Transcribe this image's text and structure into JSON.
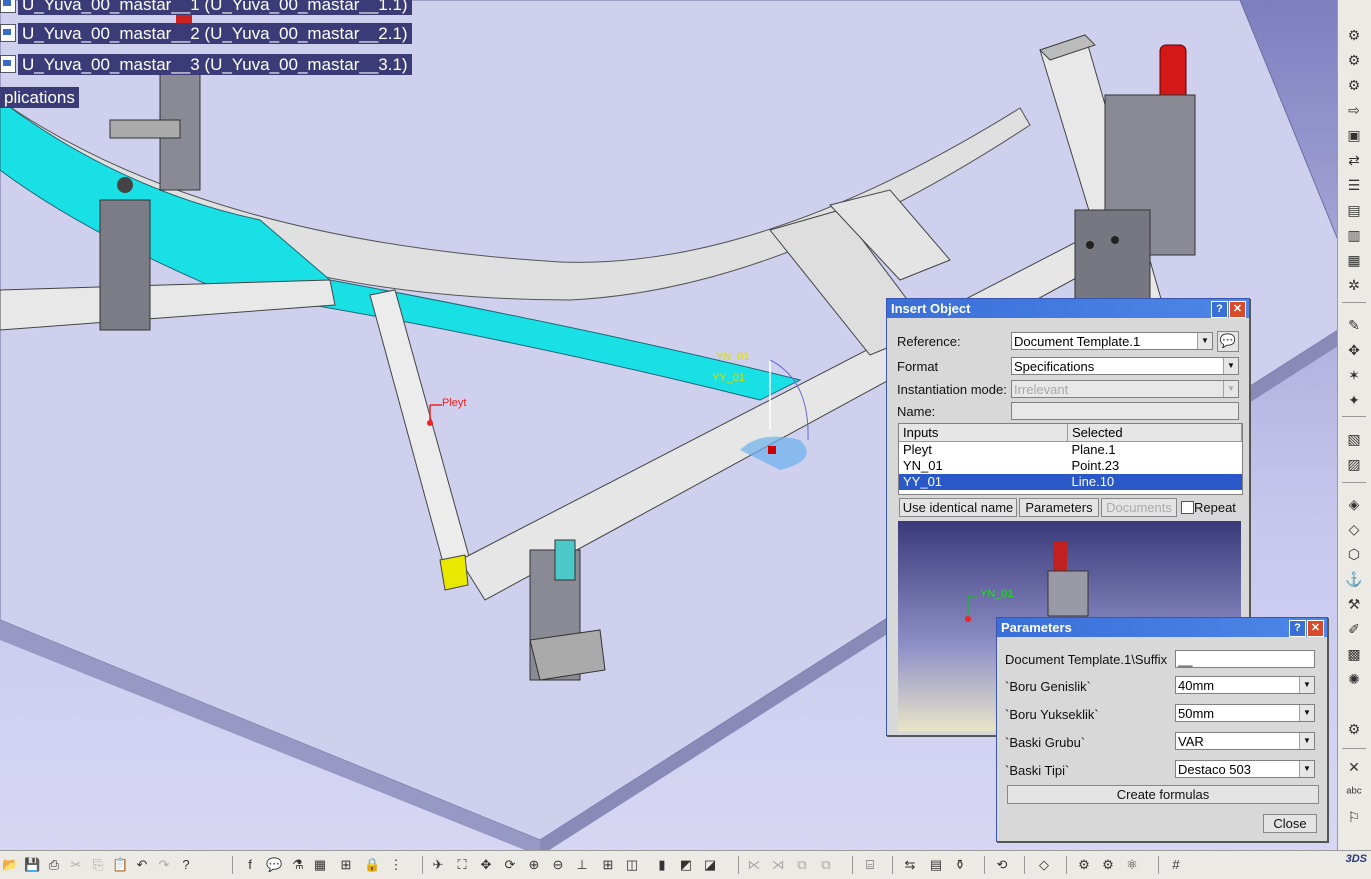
{
  "tree": {
    "nodes": [
      "U_Yuva_00_mastar__1 (U_Yuva_00_mastar__1.1)",
      "U_Yuva_00_mastar__2 (U_Yuva_00_mastar__2.1)",
      "U_Yuva_00_mastar__3 (U_Yuva_00_mastar__3.1)"
    ],
    "applications": "plications"
  },
  "viewport_labels": {
    "pleyt": "Pleyt",
    "yn01": "YN_01",
    "yy01": "YY_01"
  },
  "insert_object": {
    "title": "Insert Object",
    "reference_label": "Reference:",
    "reference_value": "Document Template.1",
    "format_label": "Format",
    "format_value": "Specifications",
    "instantiation_label": "Instantiation mode:",
    "instantiation_value": "Irrelevant",
    "name_label": "Name:",
    "name_value": "",
    "table_headers": [
      "Inputs",
      "Selected"
    ],
    "rows": [
      {
        "input": "Pleyt",
        "selected": "Plane.1"
      },
      {
        "input": "YN_01",
        "selected": "Point.23"
      },
      {
        "input": "YY_01",
        "selected": "Line.10"
      }
    ],
    "use_identical_name": "Use identical name",
    "parameters_button": "Parameters",
    "documents_button": "Documents",
    "repeat_label": "Repeat",
    "preview_label": "YN_01"
  },
  "parameters": {
    "title": "Parameters",
    "rows": [
      {
        "label": "Document Template.1\\Suffix",
        "value": "__"
      },
      {
        "label": "`Boru Genislik`",
        "value": "40mm"
      },
      {
        "label": "`Boru Yukseklik`",
        "value": "50mm"
      },
      {
        "label": "`Baski Grubu`",
        "value": "VAR"
      },
      {
        "label": "`Baski Tipi`",
        "value": "Destaco 503"
      }
    ],
    "create_formulas": "Create formulas",
    "close": "Close"
  },
  "colors": {
    "background_top": "#7e7ec0",
    "plate": "#cfd0ee",
    "tube": "#e6e6e6",
    "cyan": "#19e0e4",
    "title_bar": "#3a6fd8",
    "selection": "#2a58c8"
  }
}
